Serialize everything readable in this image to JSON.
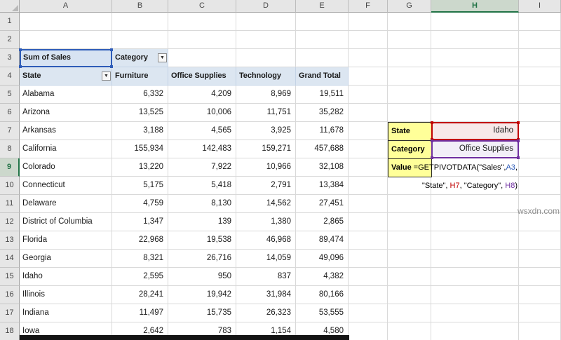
{
  "watermark": "wsxdn.com",
  "grid": {
    "column_letters": [
      "A",
      "B",
      "C",
      "D",
      "E",
      "F",
      "G",
      "H",
      "I"
    ],
    "row_numbers": [
      "1",
      "2",
      "3",
      "4",
      "5",
      "6",
      "7",
      "8",
      "9",
      "10",
      "11",
      "12",
      "13",
      "14",
      "15",
      "16",
      "17",
      "18"
    ],
    "row_count": 18,
    "selected_column": "H",
    "selected_row": 9
  },
  "icons": {
    "filter_dropdown": "▼"
  },
  "pivot": {
    "value_field_label": "Sum of Sales",
    "column_field_label": "Category",
    "row_field_label": "State",
    "column_headers": [
      "Furniture",
      "Office Supplies",
      "Technology",
      "Grand Total"
    ],
    "rows": [
      {
        "state": "Alabama",
        "values": [
          "6,332",
          "4,209",
          "8,969",
          "19,511"
        ]
      },
      {
        "state": "Arizona",
        "values": [
          "13,525",
          "10,006",
          "11,751",
          "35,282"
        ]
      },
      {
        "state": "Arkansas",
        "values": [
          "3,188",
          "4,565",
          "3,925",
          "11,678"
        ]
      },
      {
        "state": "California",
        "values": [
          "155,934",
          "142,483",
          "159,271",
          "457,688"
        ]
      },
      {
        "state": "Colorado",
        "values": [
          "13,220",
          "7,922",
          "10,966",
          "32,108"
        ]
      },
      {
        "state": "Connecticut",
        "values": [
          "5,175",
          "5,418",
          "2,791",
          "13,384"
        ]
      },
      {
        "state": "Delaware",
        "values": [
          "4,759",
          "8,130",
          "14,562",
          "27,451"
        ]
      },
      {
        "state": "District of Columbia",
        "values": [
          "1,347",
          "139",
          "1,380",
          "2,865"
        ]
      },
      {
        "state": "Florida",
        "values": [
          "22,968",
          "19,538",
          "46,968",
          "89,474"
        ]
      },
      {
        "state": "Georgia",
        "values": [
          "8,321",
          "26,716",
          "14,059",
          "49,096"
        ]
      },
      {
        "state": "Idaho",
        "values": [
          "2,595",
          "950",
          "837",
          "4,382"
        ]
      },
      {
        "state": "Illinois",
        "values": [
          "28,241",
          "19,942",
          "31,984",
          "80,166"
        ]
      },
      {
        "state": "Indiana",
        "values": [
          "11,497",
          "15,735",
          "26,323",
          "53,555"
        ]
      },
      {
        "state": "Iowa",
        "values": [
          "2,642",
          "783",
          "1,154",
          "4,580"
        ]
      }
    ]
  },
  "annotation": {
    "state_label": "State",
    "category_label": "Category",
    "value_label": "Value",
    "state_value": "Idaho",
    "category_value": "Office Supplies",
    "formula": {
      "l1_pre": "=GETPIVOTDATA(\"Sales\",",
      "l1_ref": "A3",
      "l1_post": ",",
      "l2_s1": "\"State\", ",
      "l2_ref1": "H7",
      "l2_s2": ", \"Category\", ",
      "l2_ref2": "H8",
      "l2_s3": ")"
    }
  },
  "colors": {
    "accent_green": "#217346",
    "header_fill": "#E6E6E6",
    "gridline": "#D9D9D9",
    "pivot_fill": "#DCE6F1",
    "label_yellow": "#FFFF99",
    "ref_blue": "#2E5CB8",
    "ref_red": "#C00000",
    "ref_purple": "#7030A0"
  }
}
